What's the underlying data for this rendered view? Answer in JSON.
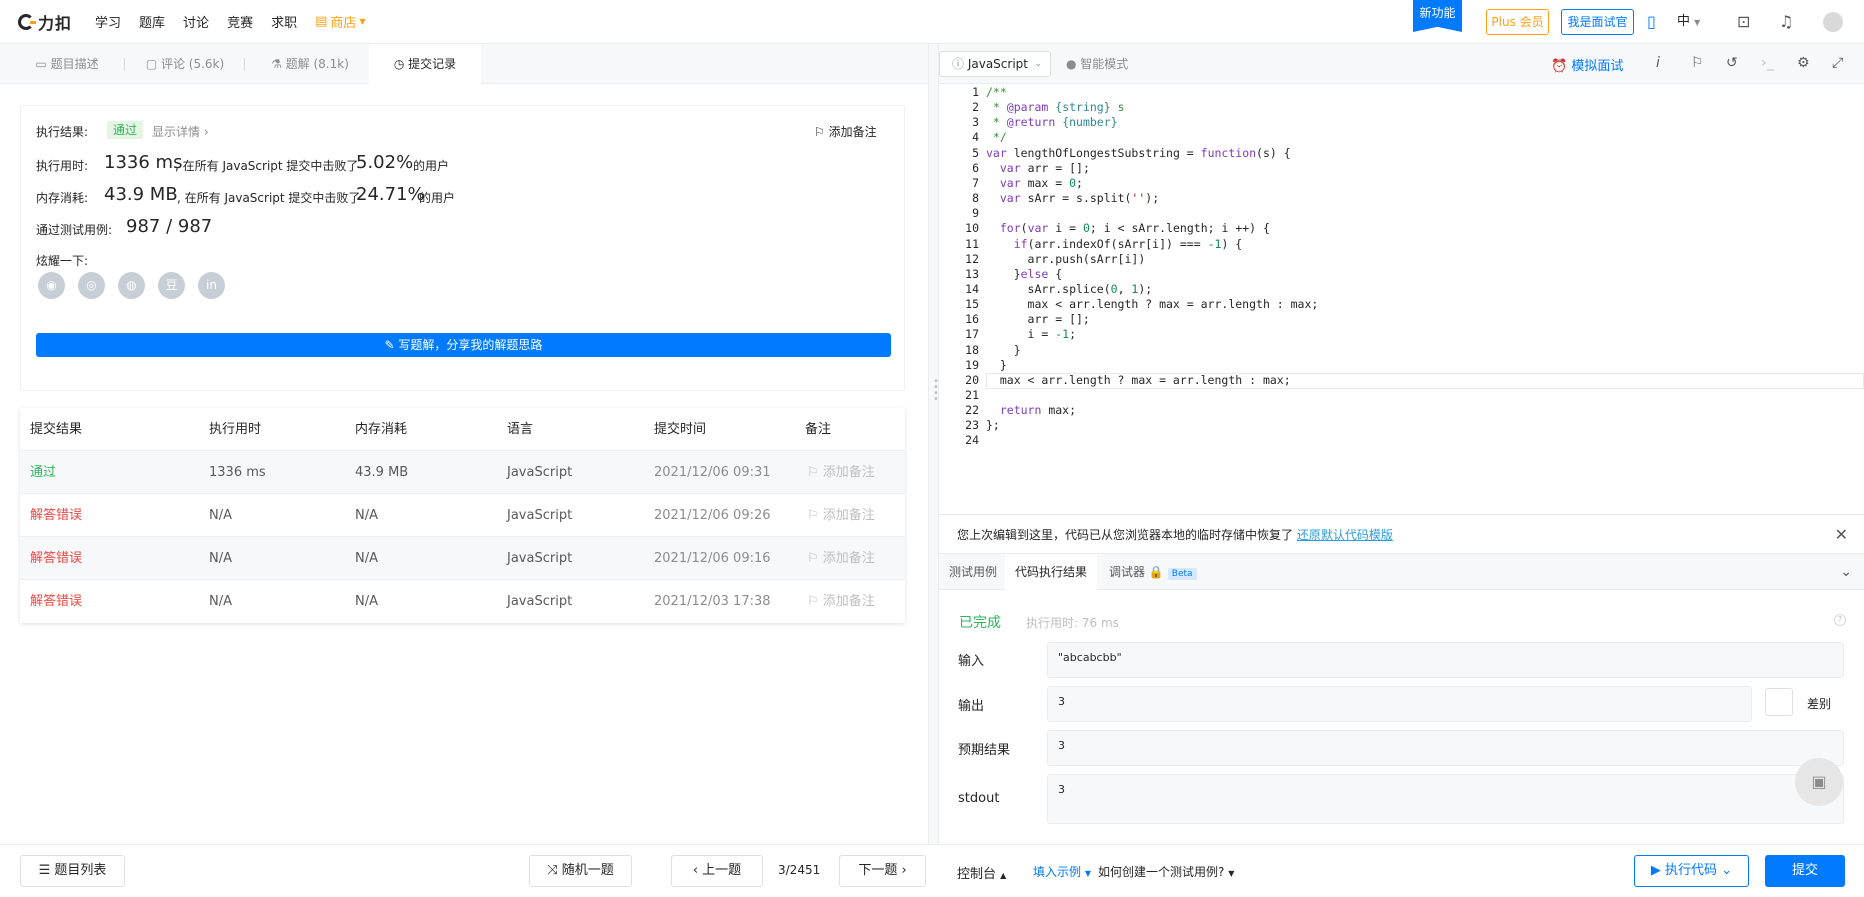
{
  "nav": {
    "logo": "力扣",
    "items": [
      "学习",
      "题库",
      "讨论",
      "竞赛",
      "求职"
    ],
    "store": "商店",
    "new_feature": "新功能",
    "plus": "Plus 会员",
    "interviewer": "我是面试官",
    "lang": "中"
  },
  "left_tabs": [
    "题目描述",
    "评论 (5.6k)",
    "题解 (8.1k)",
    "提交记录"
  ],
  "result": {
    "status_label": "执行结果:",
    "status": "通过",
    "show_detail": "显示详情 ›",
    "add_note": "添加备注",
    "time_label": "执行用时:",
    "time_value": "1336 ms",
    "time_text": ", 在所有 JavaScript 提交中击败了",
    "time_pct": "5.02%",
    "users": "的用户",
    "mem_label": "内存消耗:",
    "mem_value": "43.9 MB",
    "mem_text": ", 在所有 JavaScript 提交中击败了",
    "mem_pct": "24.71%",
    "cases_label": "通过测试用例:",
    "cases_value": "987 / 987",
    "share_label": "炫耀一下:",
    "share_icons": [
      "wechat-icon",
      "weibo-icon",
      "qq-icon",
      "douban-icon",
      "linkedin-icon"
    ],
    "share_glyphs": [
      "◉",
      "◎",
      "◍",
      "豆",
      "in"
    ],
    "write_btn": "写题解，分享我的解题思路"
  },
  "submissions": {
    "headers": [
      "提交结果",
      "执行用时",
      "内存消耗",
      "语言",
      "提交时间",
      "备注"
    ],
    "rows": [
      {
        "status": "通过",
        "time": "1336 ms",
        "memory": "43.9 MB",
        "lang": "JavaScript",
        "date": "2021/12/06 09:31",
        "note": "添加备注"
      },
      {
        "status": "解答错误",
        "time": "N/A",
        "memory": "N/A",
        "lang": "JavaScript",
        "date": "2021/12/06 09:26",
        "note": "添加备注"
      },
      {
        "status": "解答错误",
        "time": "N/A",
        "memory": "N/A",
        "lang": "JavaScript",
        "date": "2021/12/06 09:16",
        "note": "添加备注"
      },
      {
        "status": "解答错误",
        "time": "N/A",
        "memory": "N/A",
        "lang": "JavaScript",
        "date": "2021/12/03 17:38",
        "note": "添加备注"
      }
    ]
  },
  "editor": {
    "language": "JavaScript",
    "smart_mode": "智能模式",
    "mock_interview": "模拟面试",
    "code_lines": [
      "/**",
      " * @param {string} s",
      " * @return {number}",
      " */",
      "var lengthOfLongestSubstring = function(s) {",
      "  var arr = [];",
      "  var max = 0;",
      "  var sArr = s.split('');",
      "",
      "  for(var i = 0; i < sArr.length; i ++) {",
      "    if(arr.indexOf(sArr[i]) === -1) {",
      "      arr.push(sArr[i])",
      "    }else {",
      "      sArr.splice(0, 1);",
      "      max < arr.length ? max = arr.length : max;",
      "      arr = [];",
      "      i = -1;",
      "    }",
      "  }",
      "  max < arr.length ? max = arr.length : max;",
      "",
      "  return max;",
      "};",
      ""
    ]
  },
  "notice": {
    "text": "您上次编辑到这里，代码已从您浏览器本地的临时存储中恢复了",
    "link": "还原默认代码模版"
  },
  "console": {
    "tabs": [
      "测试用例",
      "代码执行结果",
      "调试器"
    ],
    "beta": "Beta",
    "status": "已完成",
    "runtime": "执行用时: 76 ms",
    "input_label": "输入",
    "input_value": "\"abcabcbb\"",
    "output_label": "输出",
    "output_value": "3",
    "diff_label": "差别",
    "expected_label": "预期结果",
    "expected_value": "3",
    "stdout_label": "stdout",
    "stdout_value": "3"
  },
  "bottom": {
    "problem_list": "题目列表",
    "random": "随机一题",
    "prev": "上一题",
    "page": "3/2451",
    "next": "下一题",
    "console": "控制台",
    "fill_example": "填入示例",
    "how_to": "如何创建一个测试用例?",
    "run": "执行代码",
    "submit": "提交"
  },
  "colors": {
    "accent": "#007aff",
    "pass": "#2db55d",
    "fail": "#ef4743",
    "store": "#ffa116"
  }
}
